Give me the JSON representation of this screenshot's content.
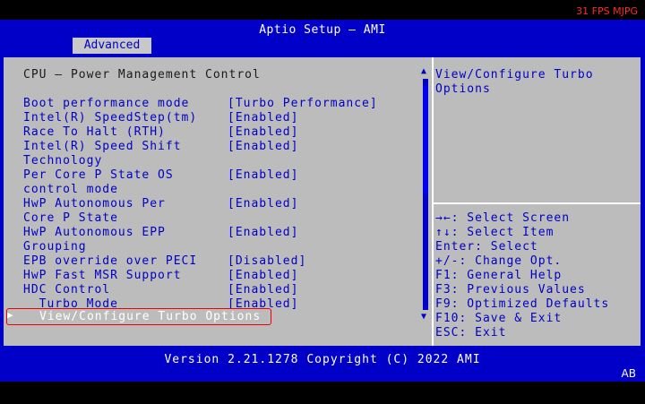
{
  "overlay": {
    "fps": "31 FPS MJPG",
    "corner": "AB"
  },
  "header": {
    "title": "Aptio Setup – AMI",
    "tab": "Advanced"
  },
  "section": {
    "title": "CPU – Power Management Control"
  },
  "settings": [
    {
      "label": "Boot performance mode",
      "value": "[Turbo Performance]"
    },
    {
      "label": "Intel(R) SpeedStep(tm)",
      "value": "[Enabled]"
    },
    {
      "label": "Race To Halt (RTH)",
      "value": "[Enabled]"
    },
    {
      "label": "Intel(R) Speed Shift",
      "value": "[Enabled]"
    },
    {
      "label": "Technology",
      "value": ""
    },
    {
      "label": "Per Core P State OS",
      "value": "[Enabled]"
    },
    {
      "label": "control mode",
      "value": ""
    },
    {
      "label": "HwP Autonomous Per",
      "value": "[Enabled]"
    },
    {
      "label": "Core P State",
      "value": ""
    },
    {
      "label": "HwP Autonomous EPP",
      "value": "[Enabled]"
    },
    {
      "label": "Grouping",
      "value": ""
    },
    {
      "label": "EPB override over PECI",
      "value": "[Disabled]"
    },
    {
      "label": "HwP Fast MSR Support",
      "value": "[Enabled]"
    },
    {
      "label": "HDC Control",
      "value": "[Enabled]"
    },
    {
      "label": "  Turbo Mode",
      "value": "[Enabled]"
    }
  ],
  "selected_item": {
    "label": "View/Configure Turbo Options"
  },
  "help": {
    "text": "View/Configure Turbo Options"
  },
  "keys": [
    "→←: Select Screen",
    "↑↓: Select Item",
    "Enter: Select",
    "+/-: Change Opt.",
    "F1: General Help",
    "F3: Previous Values",
    "F9: Optimized Defaults",
    "F10: Save & Exit",
    "ESC: Exit"
  ],
  "footer": {
    "version": "Version 2.21.1278 Copyright (C) 2022 AMI"
  },
  "colors": {
    "bios_blue": "#0000c8",
    "panel_gray": "#bcbcbc",
    "highlight_red": "#e00000"
  }
}
